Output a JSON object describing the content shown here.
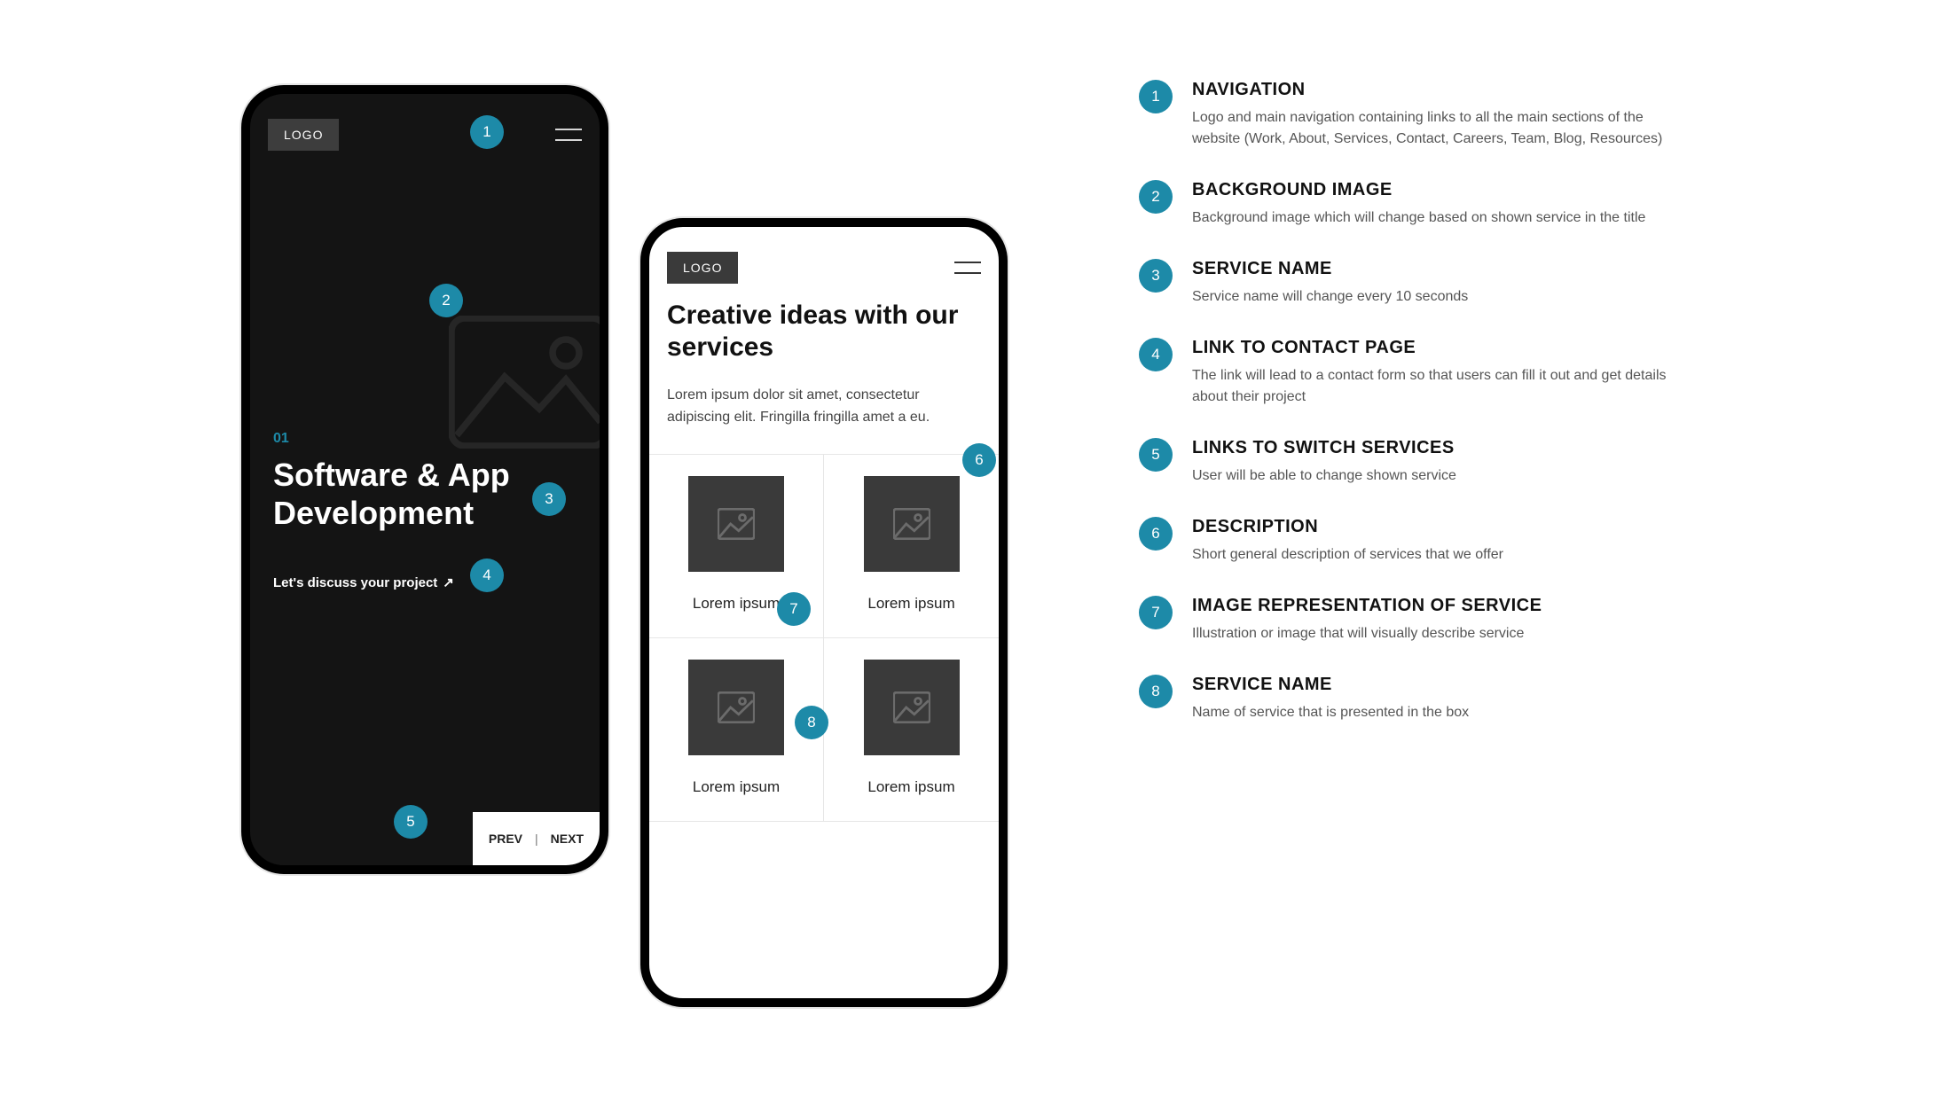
{
  "badges": [
    "1",
    "2",
    "3",
    "4",
    "5",
    "6",
    "7",
    "8"
  ],
  "accent": "#1d8aa8",
  "phone_dark": {
    "logo": "LOGO",
    "hero_number": "01",
    "hero_title": "Software & App Development",
    "cta": "Let's discuss your project",
    "cta_arrow": "↗",
    "prev": "PREV",
    "sep": "|",
    "next": "NEXT"
  },
  "phone_light": {
    "logo": "LOGO",
    "title": "Creative ideas with our services",
    "desc": "Lorem ipsum dolor sit amet, consectetur adipiscing elit. Fringilla fringilla amet a eu.",
    "cells": [
      {
        "label": "Lorem ipsum"
      },
      {
        "label": "Lorem ipsum"
      },
      {
        "label": "Lorem ipsum"
      },
      {
        "label": "Lorem ipsum"
      }
    ]
  },
  "notes": [
    {
      "num": "1",
      "title": "NAVIGATION",
      "desc": "Logo and main navigation containing links to all the main sections of the website (Work, About, Services, Contact, Careers, Team, Blog, Resources)"
    },
    {
      "num": "2",
      "title": "BACKGROUND IMAGE",
      "desc": "Background image which will change based on shown service in the title"
    },
    {
      "num": "3",
      "title": "SERVICE NAME",
      "desc": "Service name will change every 10 seconds"
    },
    {
      "num": "4",
      "title": "LINK TO CONTACT PAGE",
      "desc": "The link will lead to a contact form so that users can fill it out and get details about their project"
    },
    {
      "num": "5",
      "title": "LINKS TO SWITCH SERVICES",
      "desc": "User will be able to change shown service"
    },
    {
      "num": "6",
      "title": "DESCRIPTION",
      "desc": "Short general description of services that we offer"
    },
    {
      "num": "7",
      "title": "IMAGE REPRESENTATION OF SERVICE",
      "desc": "Illustration or image that will visually describe service"
    },
    {
      "num": "8",
      "title": "SERVICE NAME",
      "desc": "Name of service that is presented in the box"
    }
  ]
}
